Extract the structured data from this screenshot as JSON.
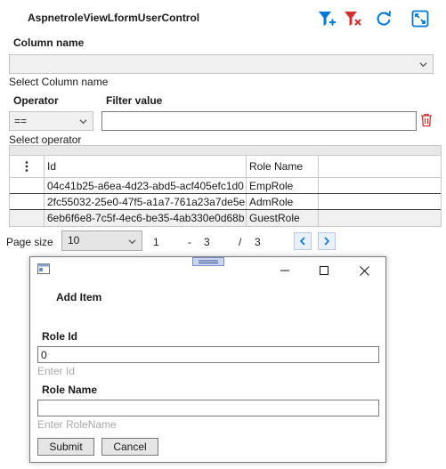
{
  "header": {
    "title": "AspnetroleViewLformUserControl"
  },
  "toolbar": [
    {
      "name": "add-filter-icon",
      "color": "#0078d7"
    },
    {
      "name": "clear-filter-icon",
      "color": "#d32f2f"
    },
    {
      "name": "refresh-icon",
      "color": "#0078d7"
    },
    {
      "name": "fullscreen-icon",
      "color": "#0078d7"
    }
  ],
  "filter": {
    "column_label": "Column name",
    "column_value": "",
    "column_hint": "Select Column name",
    "operator_label": "Operator",
    "operator_value": "==",
    "operator_hint": "Select operator",
    "filter_value_label": "Filter value",
    "filter_value": ""
  },
  "grid": {
    "columns": [
      "Id",
      "Role Name"
    ],
    "rows": [
      {
        "id": "04c41b25-a6ea-4d23-abd5-acf405efc1d0",
        "role": "EmpRole"
      },
      {
        "id": "2fc55032-25e0-47f5-a1a7-761a23a7de5e",
        "role": "AdmRole"
      },
      {
        "id": "6eb6f6e8-7c5f-4ec6-be35-4ab330e0d68b",
        "role": "GuestRole"
      }
    ]
  },
  "pager": {
    "page_size_label": "Page size",
    "page_size": "10",
    "from": "1",
    "dash": "-",
    "to": "3",
    "slash": "/",
    "total": "3"
  },
  "dialog": {
    "title": "Add Item",
    "role_id_label": "Role Id",
    "role_id_value": "0",
    "role_id_hint": "Enter Id",
    "role_name_label": "Role Name",
    "role_name_value": "",
    "role_name_hint": "Enter RoleName",
    "submit_label": "Submit",
    "cancel_label": "Cancel"
  },
  "colors": {
    "accent": "#0078d7",
    "danger": "#d32f2f",
    "placeholder": "#a9a9a9"
  }
}
